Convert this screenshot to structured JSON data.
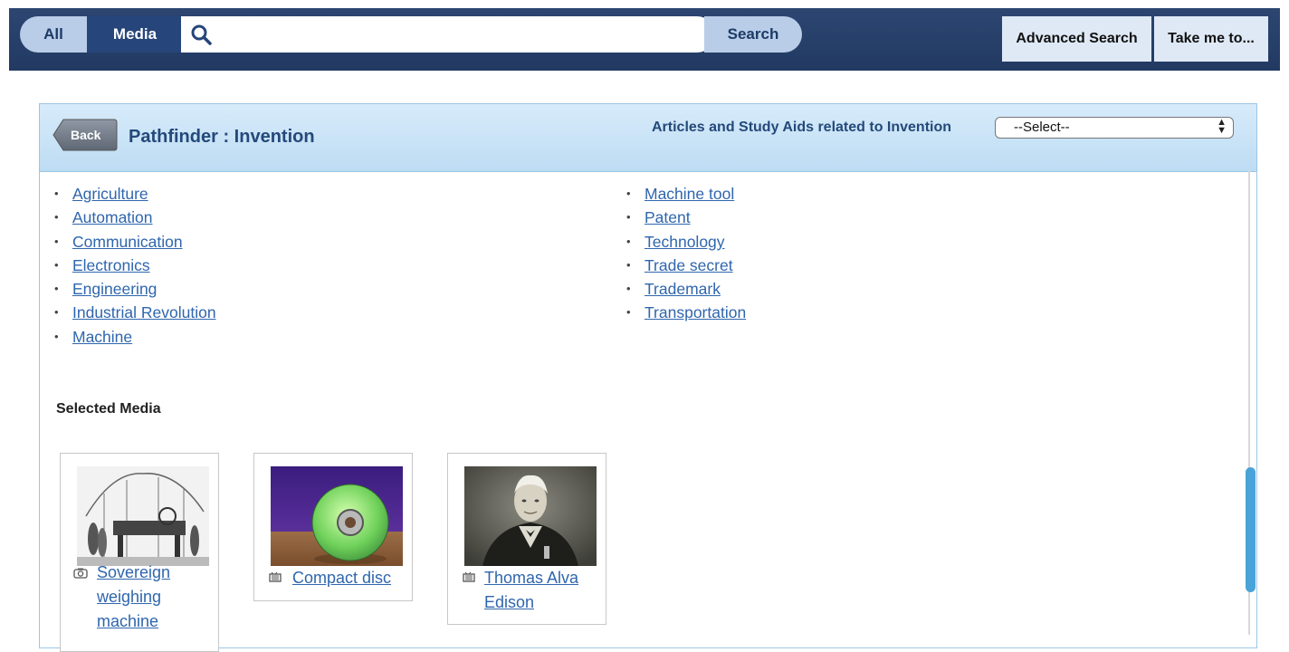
{
  "topbar": {
    "scope_all": "All",
    "scope_media": "Media",
    "search_placeholder": "",
    "search_label": "Search",
    "advanced_search": "Advanced Search",
    "take_me_to": "Take me to..."
  },
  "panel": {
    "back_label": "Back",
    "title": "Pathfinder : Invention",
    "related_label": "Articles and Study Aids related to Invention",
    "related_select_value": "--Select--"
  },
  "links": {
    "left": [
      "Agriculture",
      "Automation",
      "Communication",
      "Electronics",
      "Engineering",
      "Industrial Revolution",
      "Machine"
    ],
    "right": [
      "Machine tool",
      "Patent",
      "Technology",
      "Trade secret",
      "Trademark",
      "Transportation"
    ]
  },
  "selected_media": {
    "heading": "Selected Media",
    "items": [
      {
        "title_lines": [
          "Sovereign",
          "weighing",
          "machine"
        ],
        "icon": "camera-icon"
      },
      {
        "title_lines": [
          "Compact disc"
        ],
        "icon": "video-icon"
      },
      {
        "title_lines": [
          "Thomas Alva",
          "Edison"
        ],
        "icon": "video-icon"
      }
    ]
  },
  "colors": {
    "topbar": "#223a62",
    "link": "#2f66ad",
    "panel_header": "#bddcf3",
    "scroll_thumb": "#4aa3d8"
  }
}
